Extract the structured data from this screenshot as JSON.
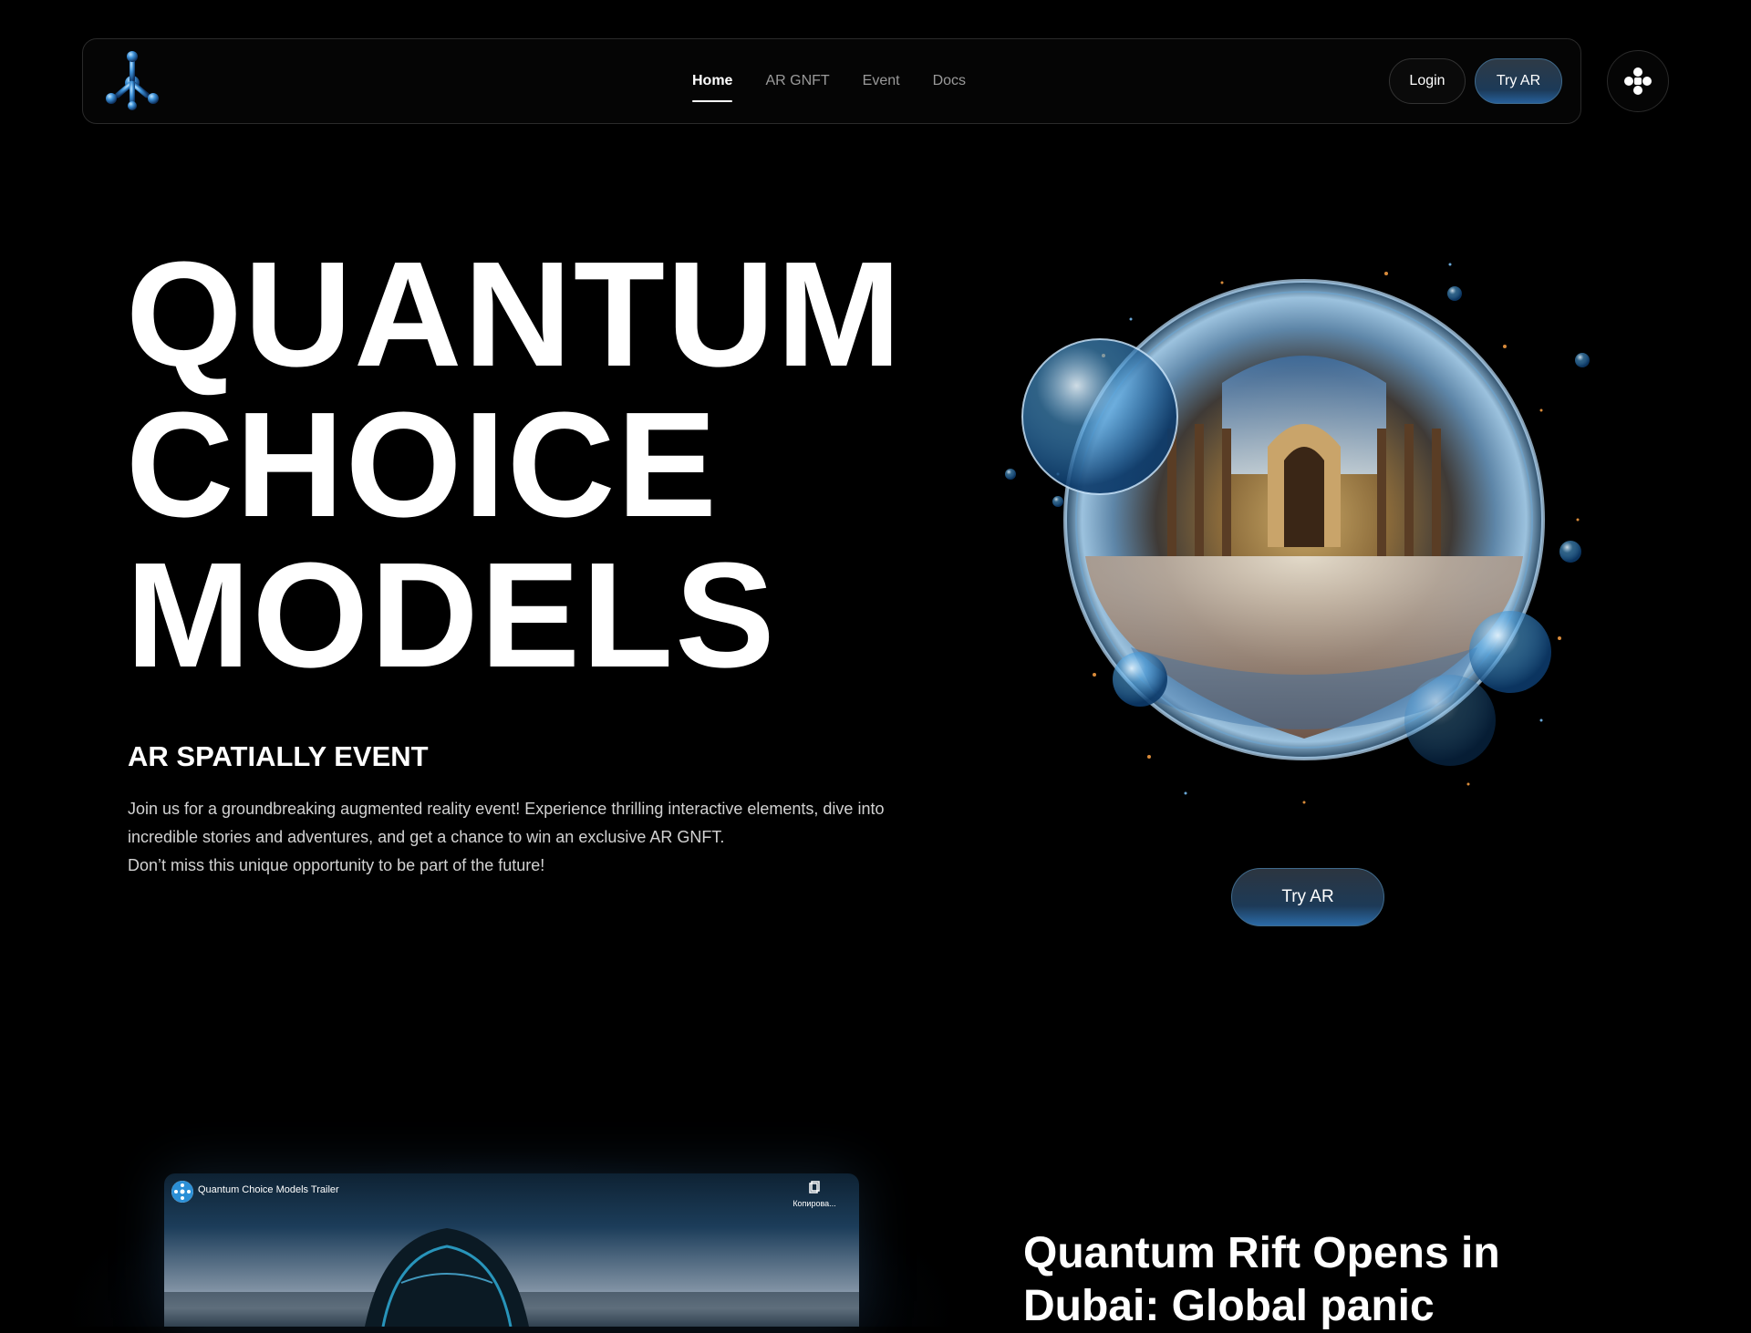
{
  "nav": {
    "links": [
      {
        "label": "Home",
        "active": true
      },
      {
        "label": "AR GNFT",
        "active": false
      },
      {
        "label": "Event",
        "active": false
      },
      {
        "label": "Docs",
        "active": false
      }
    ],
    "login_label": "Login",
    "try_ar_label": "Try AR"
  },
  "hero": {
    "title_lines": [
      "QUANTUM",
      "CHOICE",
      "MODELS"
    ],
    "subtitle": "AR SPATIALLY EVENT",
    "description_lines": [
      "Join us for a groundbreaking augmented reality event! Experience thrilling interactive elements, dive into",
      "incredible stories and adventures, and get a chance to win an exclusive AR GNFT.",
      "Don’t miss this unique opportunity to be part of the future!"
    ],
    "try_ar_label": "Try AR"
  },
  "video": {
    "title": "Quantum Choice Models Trailer",
    "copy_label": "Копирова..."
  },
  "news": {
    "title_lines": [
      "Quantum Rift Opens in",
      "Dubai: Global panic"
    ]
  },
  "colors": {
    "background": "#000000",
    "accent_blue": "#27609a",
    "text_muted": "#9a9a9a"
  },
  "icons": {
    "logo": "blue-molecule-logo",
    "menu": "four-dots-menu-icon",
    "copy": "copy-icon"
  }
}
